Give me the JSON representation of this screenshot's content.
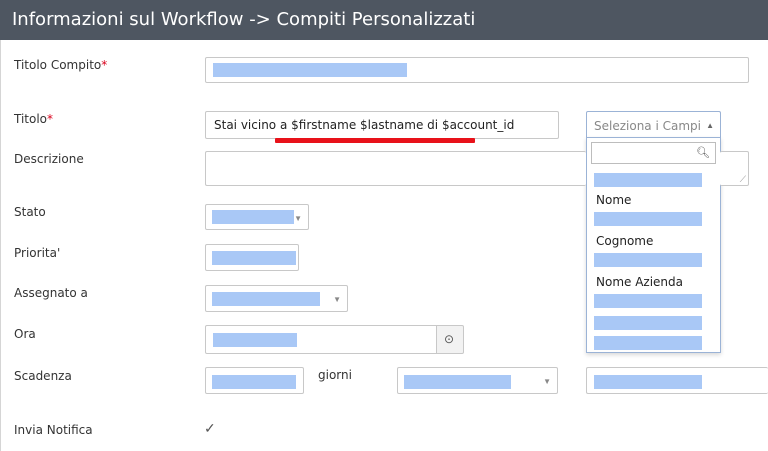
{
  "header": {
    "title": "Informazioni sul Workflow -> Compiti Personalizzati"
  },
  "fields": {
    "titolo_compito": {
      "label": "Titolo Compito",
      "required_mark": "*"
    },
    "titolo": {
      "label": "Titolo",
      "required_mark": "*",
      "value": "Stai vicino a $firstname $lastname di $account_id"
    },
    "descrizione": {
      "label": "Descrizione"
    },
    "stato": {
      "label": "Stato"
    },
    "priorita": {
      "label": "Priorita'"
    },
    "assegnato": {
      "label": "Assegnato a"
    },
    "ora": {
      "label": "Ora"
    },
    "scadenza": {
      "label": "Scadenza",
      "days_label": "giorni"
    },
    "invia_notifica": {
      "label": "Invia Notifica",
      "checked": true
    }
  },
  "field_picker": {
    "placeholder": "Seleziona i Campi",
    "options": [
      "Nome",
      "Cognome",
      "Nome Azienda"
    ]
  },
  "icons": {
    "search": "search-icon",
    "clock": "clock-icon",
    "caret": "chevron-down-icon",
    "check": "check-icon"
  },
  "colors": {
    "header_bg": "#4e5661",
    "required": "#d9001b",
    "highlight": "#e8121a",
    "redacted": "#a9c8f6"
  }
}
